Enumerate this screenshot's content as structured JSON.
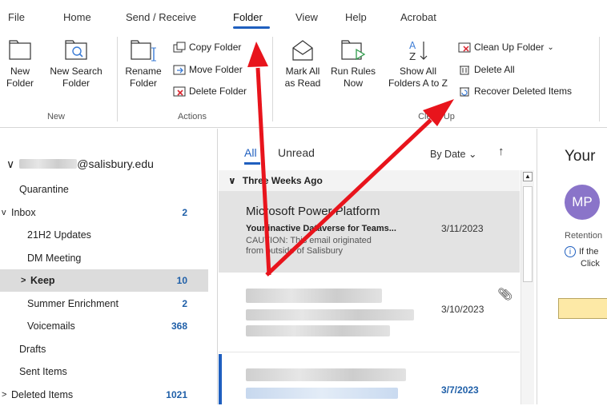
{
  "ribbon_tabs": [
    "File",
    "Home",
    "Send / Receive",
    "Folder",
    "View",
    "Help",
    "Acrobat"
  ],
  "ribbon": {
    "new_group": {
      "label": "New",
      "new_folder": "New\nFolder",
      "new_search_folder": "New Search\nFolder"
    },
    "actions_group": {
      "label": "Actions",
      "rename_folder": "Rename\nFolder",
      "copy_folder": "Copy Folder",
      "move_folder": "Move Folder",
      "delete_folder": "Delete Folder"
    },
    "cleanup_group": {
      "label": "Clean Up",
      "mark_all_read": "Mark All\nas Read",
      "run_rules_now": "Run Rules\nNow",
      "show_all_folders": "Show All\nFolders A to Z",
      "clean_up_folder": "Clean Up Folder",
      "delete_all": "Delete All",
      "recover_deleted": "Recover Deleted Items"
    }
  },
  "folder_pane": {
    "account": "@salisbury.edu",
    "folders": [
      {
        "name": "Quarantine",
        "count": "",
        "indent": false,
        "chevron": ""
      },
      {
        "name": "Inbox",
        "count": "2",
        "indent": false,
        "chevron": "v"
      },
      {
        "name": "21H2 Updates",
        "count": "",
        "indent": true,
        "chevron": ""
      },
      {
        "name": "DM Meeting",
        "count": "",
        "indent": true,
        "chevron": ""
      },
      {
        "name": "Keep",
        "count": "10",
        "indent": true,
        "chevron": ">",
        "selected": true
      },
      {
        "name": "Summer Enrichment",
        "count": "2",
        "indent": true,
        "chevron": ""
      },
      {
        "name": "Voicemails",
        "count": "368",
        "indent": true,
        "chevron": ""
      },
      {
        "name": "Drafts",
        "count": "",
        "indent": false,
        "chevron": ""
      },
      {
        "name": "Sent Items",
        "count": "",
        "indent": false,
        "chevron": ""
      },
      {
        "name": "Deleted Items",
        "count": "1021",
        "indent": false,
        "chevron": ">"
      }
    ]
  },
  "message_list": {
    "tab_all": "All",
    "tab_unread": "Unread",
    "sort": "By Date",
    "group_header": "Three Weeks Ago",
    "messages": [
      {
        "sender": "Microsoft Power Platform",
        "subject": "Your inactive Dataverse for Teams...",
        "date": "3/11/2023",
        "preview1": "CAUTION: This email originated",
        "preview2": "from outside of Salisbury"
      },
      {
        "date": "3/10/2023"
      },
      {
        "date": "3/7/2023"
      }
    ]
  },
  "reading_pane": {
    "title": "Your",
    "avatar": "MP",
    "retention": "Retention",
    "info1": "If the",
    "info2": "Click"
  },
  "colors": {
    "accent": "#1f5fbf",
    "count": "#1f5fa8",
    "arrow": "#e8141c",
    "avatar": "#8a74c9"
  }
}
